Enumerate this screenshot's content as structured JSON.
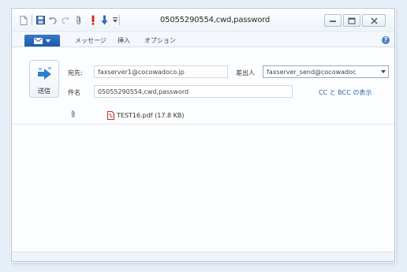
{
  "window": {
    "title": "05055290554,cwd,password"
  },
  "ribbon": {
    "file_button_icon": "mail-icon",
    "tabs": [
      {
        "label": "メッセージ"
      },
      {
        "label": "挿入"
      },
      {
        "label": "オプション"
      }
    ]
  },
  "compose": {
    "send_label": "送信",
    "to_label": "宛先:",
    "to_value": "faxserver1@cocowadoco.jp",
    "from_label": "差出人",
    "from_value": "faxserver_send@cocowadoc",
    "subject_label": "件名",
    "subject_value": "05055290554,cwd,password",
    "cc_bcc_link": "CC と BCC の表示",
    "attachment": "TEST16.pdf (17.8 KB)"
  },
  "colors": {
    "accent": "#1e5aa8",
    "link": "#2e67b1",
    "alert": "#c0392b",
    "background": "#e6eef7"
  }
}
